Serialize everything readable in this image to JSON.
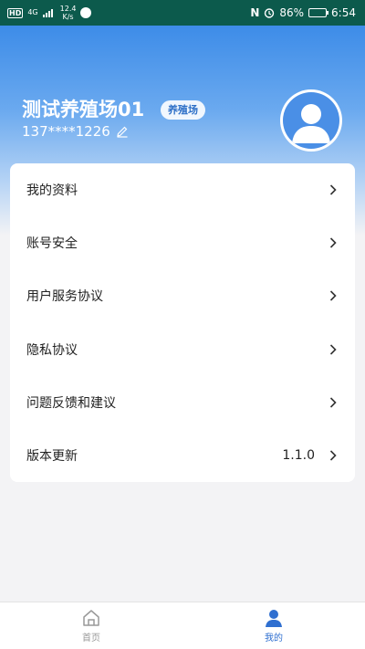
{
  "status_bar": {
    "hd": "HD",
    "network": "4G",
    "speed": "12.4",
    "speed_unit": "K/s",
    "nfc": "N",
    "battery": "86%",
    "battery_level": 0.86,
    "time": "6:54"
  },
  "profile": {
    "name": "测试养殖场01",
    "role_badge": "养殖场",
    "phone": "137****1226"
  },
  "menu": {
    "items": [
      {
        "label": "我的资料"
      },
      {
        "label": "账号安全"
      },
      {
        "label": "用户服务协议"
      },
      {
        "label": "隐私协议"
      },
      {
        "label": "问题反馈和建议"
      },
      {
        "label": "版本更新",
        "value": "1.1.0"
      }
    ]
  },
  "bottom_nav": {
    "tabs": [
      {
        "label": "首页",
        "icon": "home-icon",
        "active": false
      },
      {
        "label": "我的",
        "icon": "user-icon",
        "active": true
      }
    ]
  },
  "colors": {
    "accent": "#2f6fd0",
    "status_bar": "#0c5a4c",
    "header_gradient_top": "#3d8ce8"
  }
}
